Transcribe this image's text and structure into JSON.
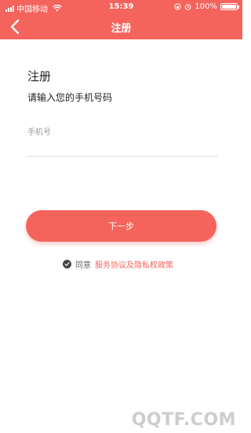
{
  "colors": {
    "accent": "#f4635c",
    "divider": "#dddddd"
  },
  "status_bar": {
    "carrier": "中国移动",
    "time": "15:39",
    "battery": "100%",
    "battery_level": 1.0
  },
  "nav": {
    "title": "注册",
    "back_icon": "chevron-left-icon"
  },
  "main": {
    "title": "注册",
    "subtitle": "请输入您的手机号码",
    "phone_placeholder": "手机号",
    "phone_value": "",
    "next_label": "下一步",
    "agree_prefix": "同意",
    "agree_link": "服务协议及隐私权政策",
    "agree_checked": true
  },
  "watermark": "QQTF.COM"
}
